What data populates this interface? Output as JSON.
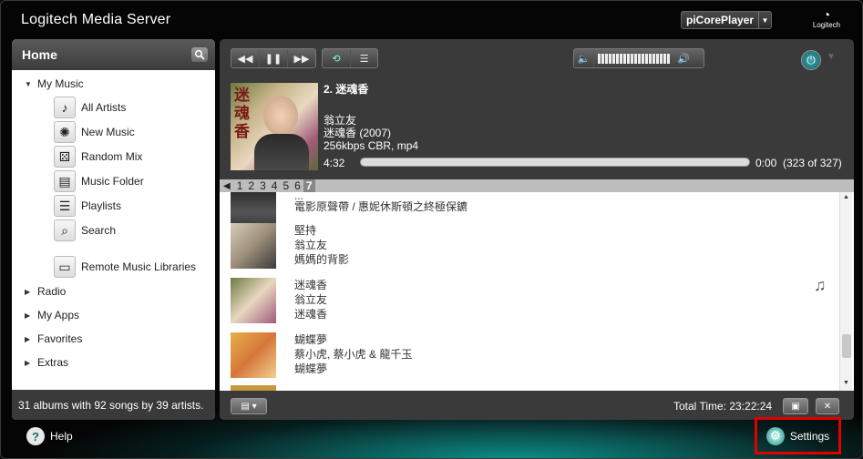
{
  "app": {
    "title": "Logitech Media Server",
    "player": "piCorePlayer",
    "logo_text": "Logitech"
  },
  "left": {
    "title": "Home",
    "my_music": "My Music",
    "items": [
      {
        "label": "All Artists",
        "icon": "artist-icon"
      },
      {
        "label": "New Music",
        "icon": "new-music-icon"
      },
      {
        "label": "Random Mix",
        "icon": "dice-icon"
      },
      {
        "label": "Music Folder",
        "icon": "folder-icon"
      },
      {
        "label": "Playlists",
        "icon": "playlist-icon"
      },
      {
        "label": "Search",
        "icon": "magnifier-icon"
      }
    ],
    "remote": "Remote Music Libraries",
    "sections": [
      "Radio",
      "My Apps",
      "Favorites",
      "Extras"
    ],
    "footer": "31 albums with 92 songs by 39 artists."
  },
  "now_playing": {
    "title": "2. 迷魂香",
    "artist": "翁立友",
    "album": "迷魂香 (2007)",
    "format": "256kbps CBR, mp4",
    "duration": "4:32",
    "elapsed": "0:00",
    "position": "(323 of 327)",
    "progress": 0.0
  },
  "pager": {
    "pages": [
      "1",
      "2",
      "3",
      "4",
      "5",
      "6",
      "7"
    ],
    "current": "7"
  },
  "playlist": [
    {
      "title": "...",
      "artist": "電影原聲帶 / 惠妮休斯頓之終極保鑣",
      "album": ""
    },
    {
      "title": "堅持",
      "artist": "翁立友",
      "album": "媽媽的背影"
    },
    {
      "title": "迷魂香",
      "artist": "翁立友",
      "album": "迷魂香"
    },
    {
      "title": "蝴蝶夢",
      "artist": "蔡小虎, 蔡小虎 & 龍千玉",
      "album": "蝴蝶夢"
    }
  ],
  "footer": {
    "total_label": "Total Time: 23:22:24"
  },
  "bottom": {
    "help": "Help",
    "settings": "Settings"
  },
  "colors": {
    "accent_teal": "#0d8f8a",
    "highlight_red": "#e00000"
  }
}
